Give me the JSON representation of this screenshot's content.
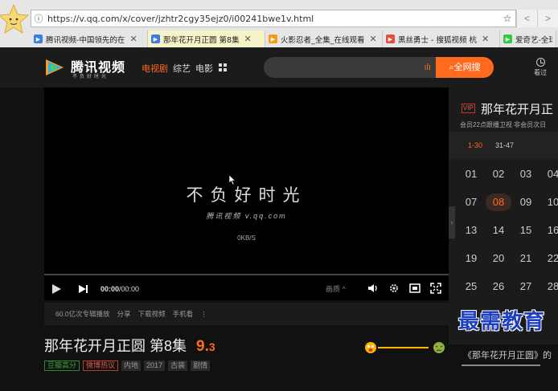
{
  "browser": {
    "url": "https://v.qq.com/x/cover/jzhtr2cgy35ejz0/i00241bwe1v.html",
    "tabs": [
      {
        "label": "腾讯视频-中国领先的在",
        "color": "#3a7fe0",
        "active": false
      },
      {
        "label": "那年花开月正圆 第8集",
        "color": "#3a7fe0",
        "active": true
      },
      {
        "label": "火影忍者_全集_在线观看",
        "color": "#f39c12",
        "active": false
      },
      {
        "label": "黑丝勇士 - 搜狐视频 杭",
        "color": "#e74c3c",
        "active": false
      },
      {
        "label": "爱奇艺-全球领",
        "color": "#2ecc40",
        "active": false
      }
    ]
  },
  "site": {
    "logo_text": "腾讯视频",
    "logo_sub": "不负好时光",
    "nav": [
      {
        "label": "电视剧",
        "active": true
      },
      {
        "label": "综艺",
        "active": false
      },
      {
        "label": "电影",
        "active": false
      }
    ],
    "search_button": "全网搜",
    "history_label": "看过"
  },
  "player": {
    "slogan": "不负好时光",
    "brand_line": "腾讯视频 v.qq.com",
    "speed": "0KB/S",
    "time_current": "00:00",
    "time_total": "/00:00",
    "quality": "画质 ^"
  },
  "sub_bar": [
    "60.0亿次专辑播放",
    "分享",
    "下载视频",
    "手机看",
    "⋮"
  ],
  "show": {
    "title": "那年花开月正圆 第8集",
    "rating_int": "9.",
    "rating_dec": "3",
    "tags": [
      "豆瓣高分",
      "微博热议",
      "内地",
      "2017",
      "古装",
      "剧情"
    ]
  },
  "side_panel": {
    "vip": "VIP",
    "title": "那年花开月正",
    "note": "会员22点跟播卫视 非会员次日",
    "ranges": [
      {
        "label": "1-30",
        "active": true
      },
      {
        "label": "31-47",
        "active": false
      }
    ],
    "episodes": [
      "01",
      "02",
      "03",
      "04",
      "07",
      "08",
      "09",
      "10",
      "13",
      "14",
      "15",
      "16",
      "19",
      "20",
      "21",
      "22",
      "25",
      "26",
      "27",
      "28"
    ],
    "active_episode": "08",
    "bottom_text": "《那年花开月正圆》的"
  },
  "watermark": "最需教育"
}
